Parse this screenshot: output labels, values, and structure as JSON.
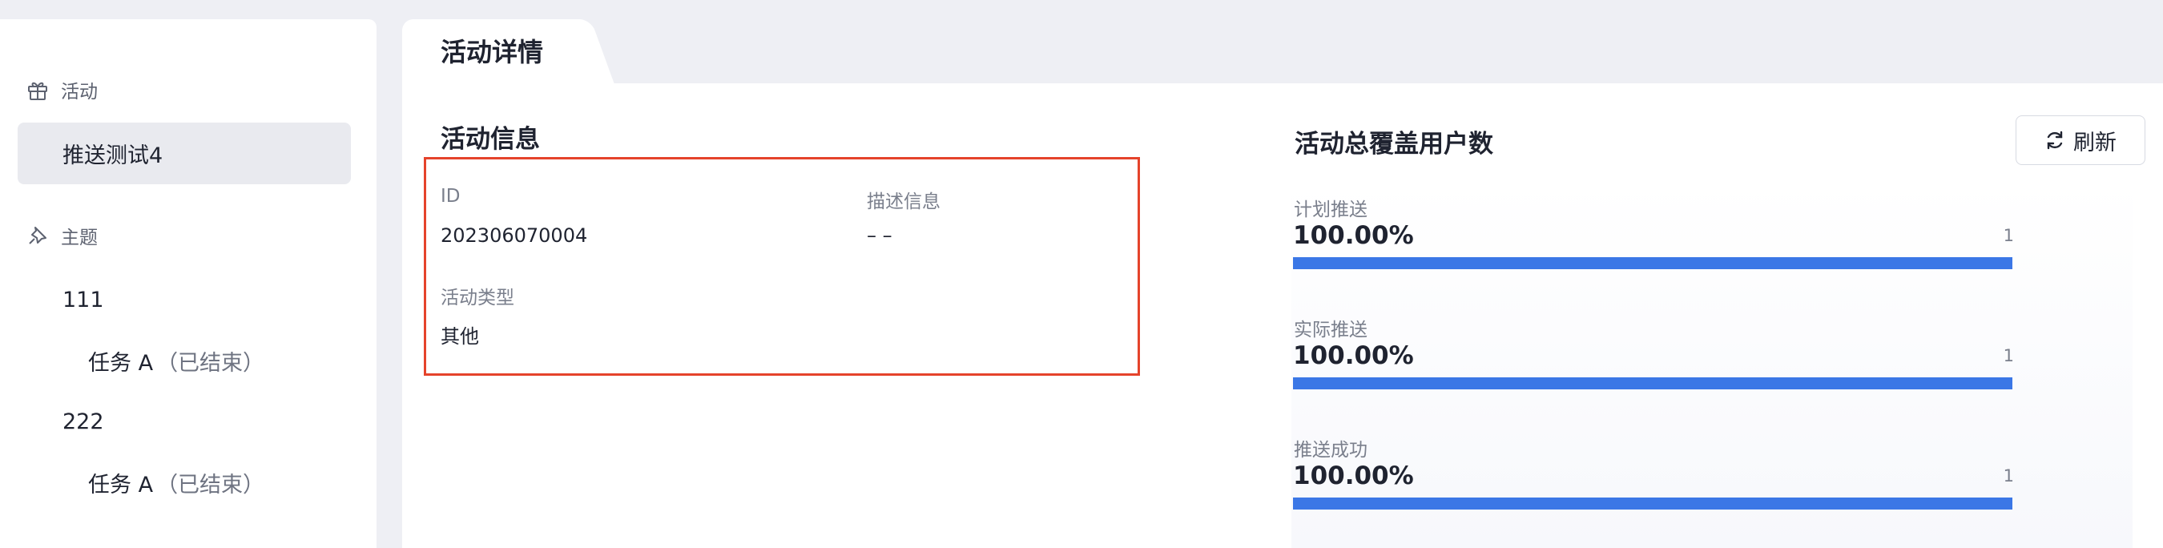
{
  "sidebar": {
    "activity_section": "活动",
    "active_item": "推送测试4",
    "topic_section": "主题",
    "topics": [
      {
        "name": "111",
        "task": "任务 A",
        "status": "（已结束）"
      },
      {
        "name": "222",
        "task": "任务 A",
        "status": "（已结束）"
      }
    ]
  },
  "main": {
    "tab_label": "活动详情",
    "info": {
      "title": "活动信息",
      "id_label": "ID",
      "id_value": "202306070004",
      "desc_label": "描述信息",
      "desc_value": "– –",
      "type_label": "活动类型",
      "type_value": "其他"
    },
    "coverage": {
      "title": "活动总覆盖用户数",
      "refresh_label": "刷新",
      "metrics": [
        {
          "label": "计划推送",
          "percent_text": "100.00%",
          "count": "1",
          "fill": 1.0
        },
        {
          "label": "实际推送",
          "percent_text": "100.00%",
          "count": "1",
          "fill": 1.0
        },
        {
          "label": "推送成功",
          "percent_text": "100.00%",
          "count": "1",
          "fill": 1.0
        }
      ]
    }
  },
  "colors": {
    "accent_bar": "#3b77e6",
    "highlight_border": "#e5432b",
    "page_background": "#eeeff4"
  }
}
